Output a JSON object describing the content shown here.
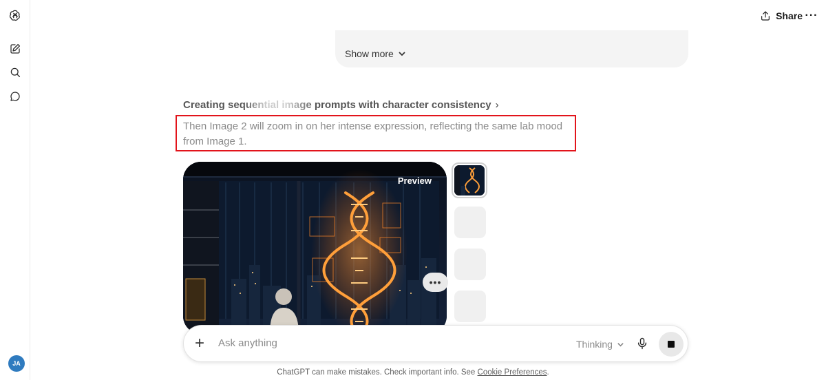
{
  "header": {
    "share_label": "Share",
    "more_icon": "ellipsis-icon"
  },
  "sidebar": {
    "items": [
      {
        "icon": "new-chat-icon"
      },
      {
        "icon": "search-icon"
      },
      {
        "icon": "chat-bubble-icon"
      }
    ],
    "avatar_initials": "JA",
    "avatar_color": "#2f7bbf"
  },
  "previous_message": {
    "show_more_label": "Show more"
  },
  "thinking": {
    "title": "Creating sequential image prompts with character consistency",
    "chevron": "›",
    "text": "Then Image 2 will zoom in on her intense expression, reflecting the same lab mood from Image 1.",
    "highlight_color": "#e2141b"
  },
  "image_preview": {
    "label": "Preview",
    "options_label": "•••",
    "thumbnail_count": 4
  },
  "composer": {
    "plus_label": "+",
    "placeholder": "Ask anything",
    "model_label": "Thinking",
    "mic_icon": "microphone-icon",
    "stop_icon": "stop-icon"
  },
  "footer": {
    "text": "ChatGPT can make mistakes. Check important info. See",
    "link": "Cookie Preferences",
    "end": "."
  }
}
